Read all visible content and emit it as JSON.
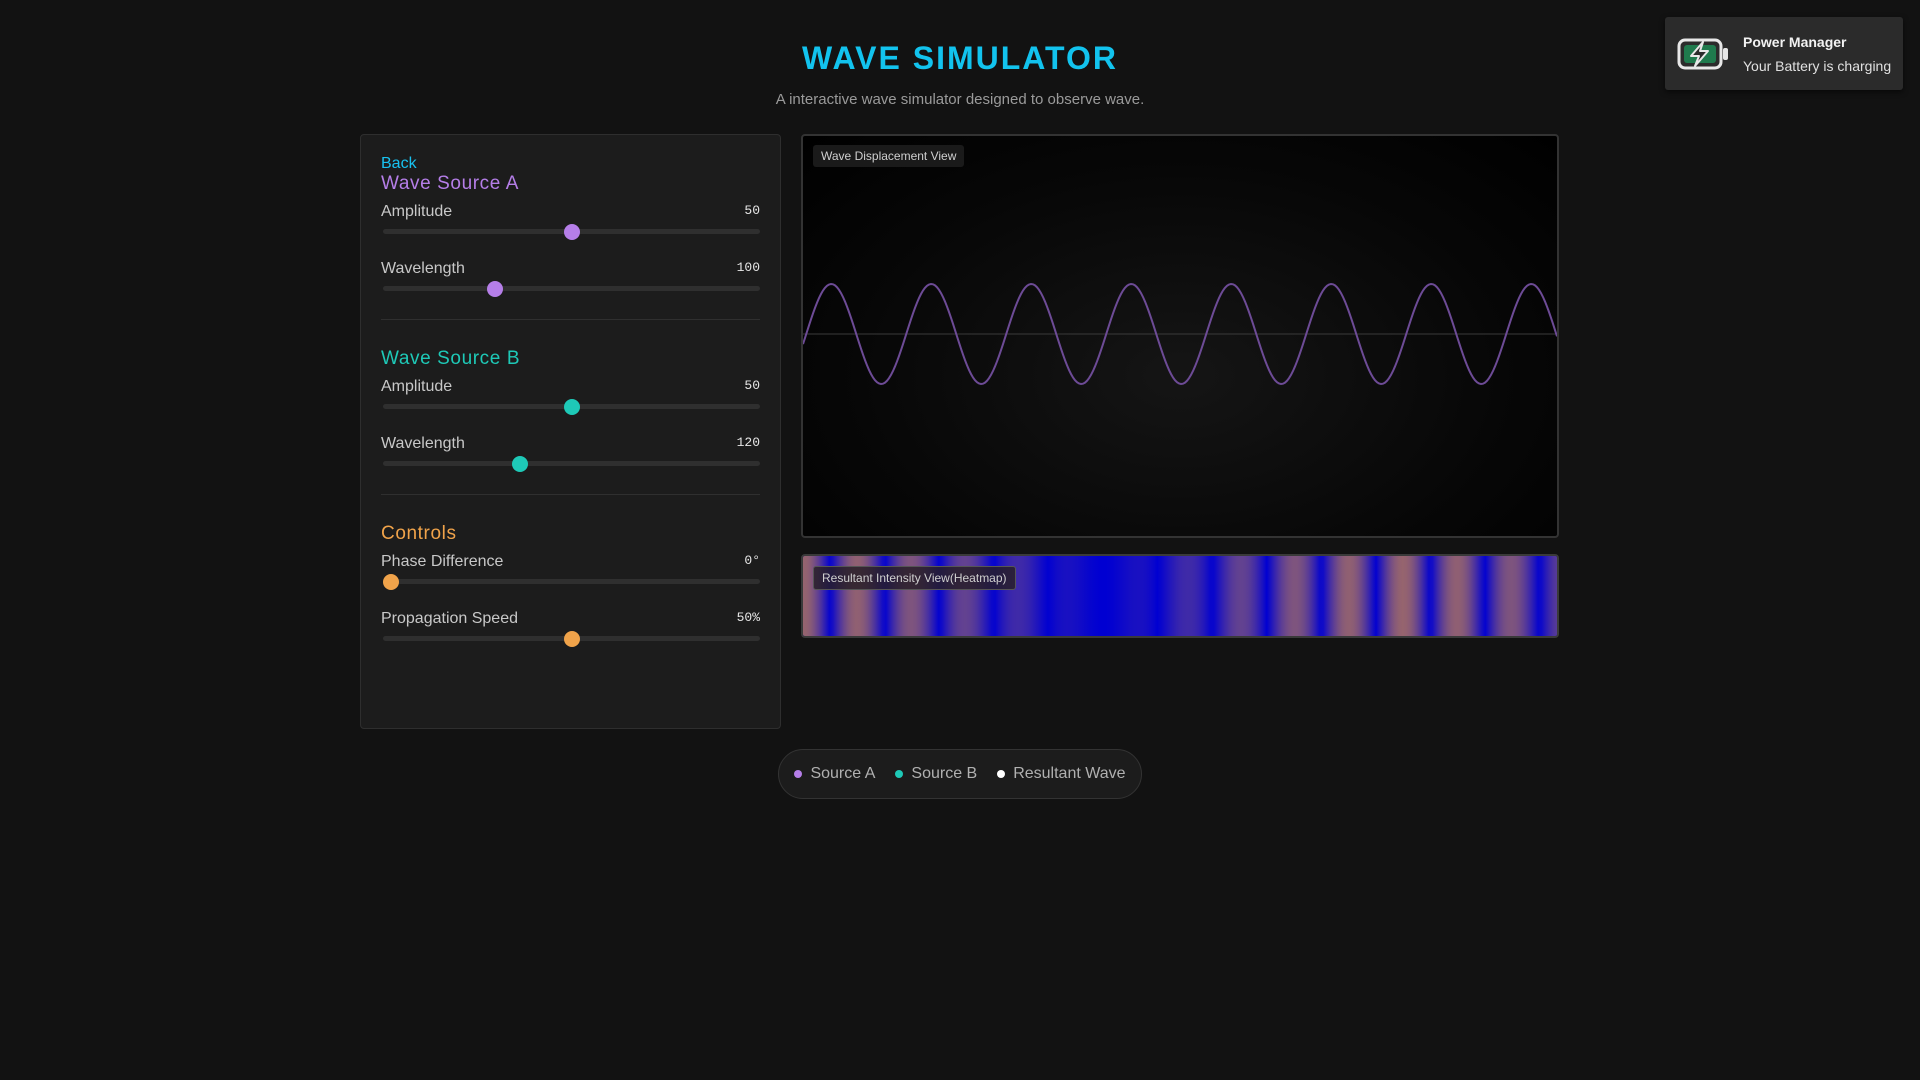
{
  "header": {
    "title": "WAVE SIMULATOR",
    "subtitle": "A interactive wave simulator designed to observe wave."
  },
  "toast": {
    "icon": "battery-charging-icon",
    "title": "Power Manager",
    "message": "Your Battery is charging"
  },
  "panel": {
    "back_label": "Back",
    "source_a": {
      "title": "Wave Source A",
      "color": "#b57ee8",
      "amplitude": {
        "label": "Amplitude",
        "value": "50",
        "fraction": 0.5
      },
      "wavelength": {
        "label": "Wavelength",
        "value": "100",
        "fraction": 0.296
      }
    },
    "source_b": {
      "title": "Wave Source B",
      "color": "#1ec9b7",
      "amplitude": {
        "label": "Amplitude",
        "value": "50",
        "fraction": 0.5
      },
      "wavelength": {
        "label": "Wavelength",
        "value": "120",
        "fraction": 0.364
      }
    },
    "controls": {
      "title": "Controls",
      "color": "#f0a34a",
      "phase": {
        "label": "Phase Difference",
        "value": "0°",
        "fraction": 0.02
      },
      "speed": {
        "label": "Propagation Speed",
        "value": "50%",
        "fraction": 0.5
      }
    }
  },
  "views": {
    "displacement_label": "Wave Displacement View",
    "heatmap_label": "Resultant Intensity View(Heatmap)",
    "wave_color": "#6d4b96"
  },
  "legend": [
    {
      "label": "Source A",
      "color": "#b57ee8"
    },
    {
      "label": "Source B",
      "color": "#1ec9b7"
    },
    {
      "label": "Resultant Wave",
      "color": "#ffffff"
    }
  ]
}
